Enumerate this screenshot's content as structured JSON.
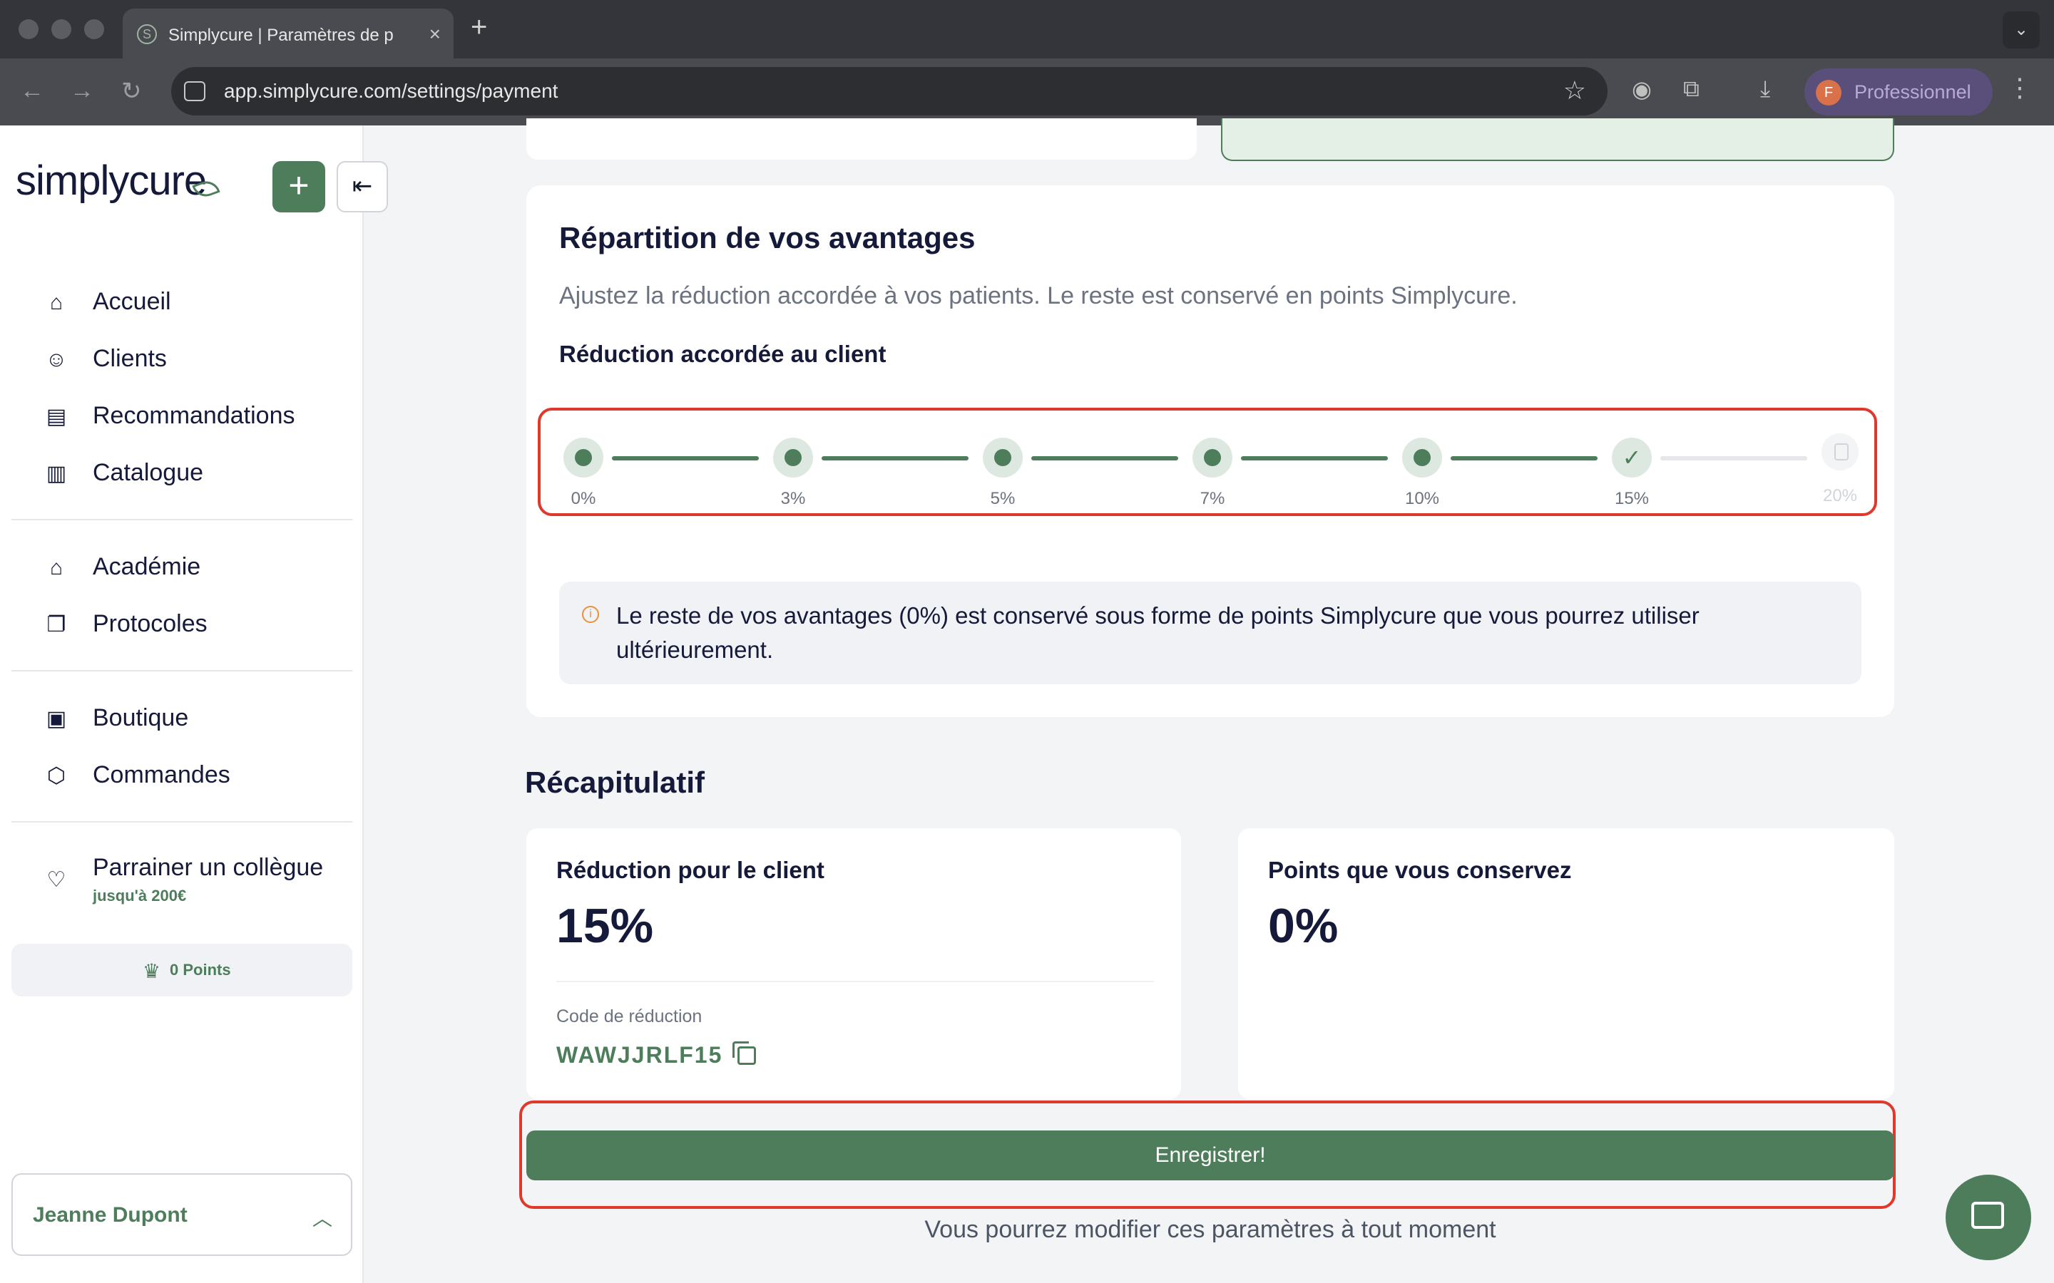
{
  "browser": {
    "tab_title": "Simplycure | Paramètres de p",
    "url": "app.simplycure.com/settings/payment",
    "profile_initial": "F",
    "profile_label": "Professionnel",
    "new_tab": "+",
    "tab_close": "×"
  },
  "sidebar": {
    "logo": "simplycure",
    "add_glyph": "+",
    "collapse_glyph": "⇤",
    "nav": [
      {
        "label": "Accueil",
        "icon": "home-icon"
      },
      {
        "label": "Clients",
        "icon": "users-icon"
      },
      {
        "label": "Recommandations",
        "icon": "document-icon"
      },
      {
        "label": "Catalogue",
        "icon": "book-icon"
      },
      {
        "label": "Académie",
        "icon": "graduation-cap-icon"
      },
      {
        "label": "Protocoles",
        "icon": "copy-icon"
      },
      {
        "label": "Boutique",
        "icon": "shopping-bag-icon"
      },
      {
        "label": "Commandes",
        "icon": "package-icon"
      }
    ],
    "referral": {
      "label": "Parrainer un collègue",
      "sub": "jusqu'à 200€"
    },
    "points": "0 Points",
    "user": "Jeanne Dupont"
  },
  "main": {
    "section_title": "Répartition de vos avantages",
    "section_desc": "Ajustez la réduction accordée à vos patients. Le reste est conservé en points Simplycure.",
    "slider_title": "Réduction accordée au client",
    "steps": [
      {
        "label": "0%"
      },
      {
        "label": "3%"
      },
      {
        "label": "5%"
      },
      {
        "label": "7%"
      },
      {
        "label": "10%"
      },
      {
        "label": "15%"
      },
      {
        "label": "20%"
      }
    ],
    "selected_step": "15%",
    "info_text": "Le reste de vos avantages (0%) est conservé sous forme de points Simplycure que vous pourrez utiliser ultérieurement.",
    "recap_title": "Récapitulatif",
    "client_card": {
      "label": "Réduction pour le client",
      "value": "15%",
      "code_label": "Code de réduction",
      "code": "WAWJJRLF15"
    },
    "points_card": {
      "label": "Points que vous conservez",
      "value": "0%"
    },
    "save_button": "Enregistrer!",
    "footnote": "Vous pourrez modifier ces paramètres à tout moment"
  },
  "colors": {
    "brand_green": "#4e7d5c",
    "text_dark": "#161a3a",
    "highlight_red": "#e0392b"
  }
}
